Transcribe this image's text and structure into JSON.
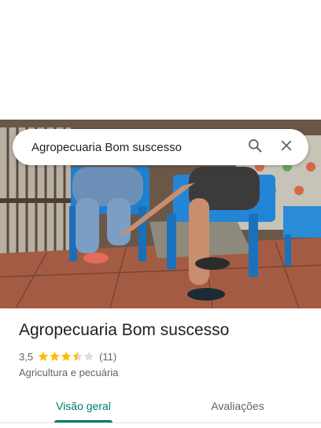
{
  "search": {
    "query": "Agropecuaria Bom suscesso"
  },
  "icons": {
    "search": "search-icon",
    "close": "close-icon",
    "star": "star-icon"
  },
  "place": {
    "title": "Agropecuaria Bom suscesso",
    "rating": "3,5",
    "rating_value": 3.5,
    "rating_max": 5,
    "review_count": "(11)",
    "category": "Agricultura e pecuária"
  },
  "tabs": [
    {
      "label": "Visão geral",
      "selected": true
    },
    {
      "label": "Avaliações",
      "selected": false
    }
  ],
  "colors": {
    "accent": "#00796b",
    "star": "#fbbc04",
    "star_empty": "#dadce0"
  }
}
